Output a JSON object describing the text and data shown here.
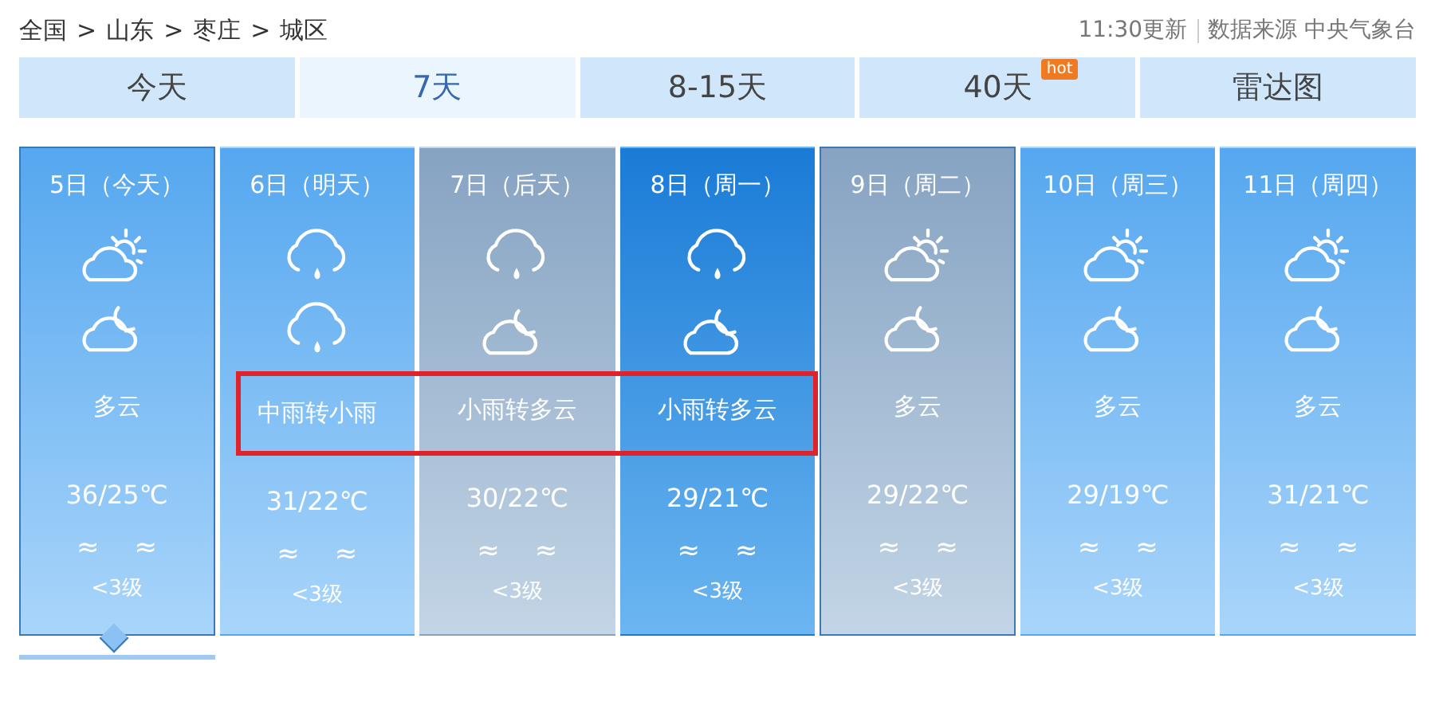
{
  "breadcrumb": [
    "全国",
    ">",
    "山东",
    ">",
    "枣庄",
    ">",
    "城区"
  ],
  "update": {
    "time": "11:30更新",
    "source": "数据来源 中央气象台"
  },
  "tabs": [
    {
      "label": "今天",
      "selected": false
    },
    {
      "label": "7天",
      "selected": true
    },
    {
      "label": "8-15天",
      "selected": false
    },
    {
      "label": "40天",
      "selected": false,
      "badge": "hot"
    },
    {
      "label": "雷达图",
      "selected": false
    }
  ],
  "days": [
    {
      "date": "5日（今天）",
      "kind": "blue",
      "selected": true,
      "framed": true,
      "icons": [
        {
          "kind": "partly-sunny"
        },
        {
          "kind": "cloudy-night"
        }
      ],
      "weather": "多云",
      "highlighted": false,
      "temp": "36/25℃",
      "wind": [
        "≈",
        "≈"
      ],
      "level": "<3级"
    },
    {
      "date": "6日（明天）",
      "kind": "blue",
      "selected": false,
      "framed": false,
      "icons": [
        {
          "kind": "rain"
        },
        {
          "kind": "rain"
        }
      ],
      "weather": "中雨转小雨",
      "highlighted": true,
      "temp": "31/22℃",
      "wind": [
        "≈",
        "≈"
      ],
      "level": "<3级"
    },
    {
      "date": "7日（后天）",
      "kind": "grey",
      "selected": false,
      "framed": false,
      "icons": [
        {
          "kind": "rain"
        },
        {
          "kind": "cloudy-night"
        }
      ],
      "weather": "小雨转多云",
      "highlighted": true,
      "temp": "30/22℃",
      "wind": [
        "≈",
        "≈"
      ],
      "level": "<3级"
    },
    {
      "date": "8日（周一）",
      "kind": "deep",
      "selected": false,
      "framed": false,
      "icons": [
        {
          "kind": "rain"
        },
        {
          "kind": "cloudy-night"
        }
      ],
      "weather": "小雨转多云",
      "highlighted": true,
      "temp": "29/21℃",
      "wind": [
        "≈",
        "≈"
      ],
      "level": "<3级"
    },
    {
      "date": "9日（周二）",
      "kind": "grey",
      "selected": false,
      "framed": true,
      "icons": [
        {
          "kind": "partly-sunny"
        },
        {
          "kind": "cloudy-night"
        }
      ],
      "weather": "多云",
      "highlighted": false,
      "temp": "29/22℃",
      "wind": [
        "≈",
        "≈"
      ],
      "level": "<3级"
    },
    {
      "date": "10日（周三）",
      "kind": "blue",
      "selected": false,
      "framed": false,
      "icons": [
        {
          "kind": "partly-sunny"
        },
        {
          "kind": "cloudy-night"
        }
      ],
      "weather": "多云",
      "highlighted": false,
      "temp": "29/19℃",
      "wind": [
        "≈",
        "≈"
      ],
      "level": "<3级"
    },
    {
      "date": "11日（周四）",
      "kind": "blue",
      "selected": false,
      "framed": false,
      "icons": [
        {
          "kind": "partly-sunny"
        },
        {
          "kind": "cloudy-night"
        }
      ],
      "weather": "多云",
      "highlighted": false,
      "temp": "31/21℃",
      "wind": [
        "≈",
        "≈"
      ],
      "level": "<3级"
    }
  ]
}
